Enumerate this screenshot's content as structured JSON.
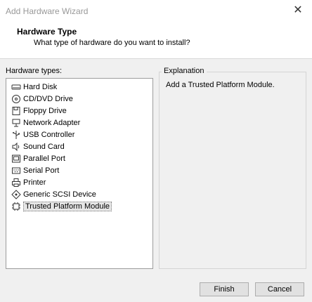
{
  "window": {
    "title": "Add Hardware Wizard",
    "close_glyph": "✕"
  },
  "header": {
    "title": "Hardware Type",
    "subtitle": "What type of hardware do you want to install?"
  },
  "hardware_list": {
    "label": "Hardware types:",
    "selected_index": 10,
    "items": [
      {
        "label": "Hard Disk",
        "icon": "hard-disk-icon"
      },
      {
        "label": "CD/DVD Drive",
        "icon": "cd-dvd-icon"
      },
      {
        "label": "Floppy Drive",
        "icon": "floppy-icon"
      },
      {
        "label": "Network Adapter",
        "icon": "network-adapter-icon"
      },
      {
        "label": "USB Controller",
        "icon": "usb-icon"
      },
      {
        "label": "Sound Card",
        "icon": "speaker-icon"
      },
      {
        "label": "Parallel Port",
        "icon": "parallel-port-icon"
      },
      {
        "label": "Serial Port",
        "icon": "serial-port-icon"
      },
      {
        "label": "Printer",
        "icon": "printer-icon"
      },
      {
        "label": "Generic SCSI Device",
        "icon": "scsi-icon"
      },
      {
        "label": "Trusted Platform Module",
        "icon": "tpm-icon"
      }
    ]
  },
  "explanation": {
    "label": "Explanation",
    "text": "Add a Trusted Platform Module."
  },
  "buttons": {
    "finish": "Finish",
    "cancel": "Cancel"
  }
}
